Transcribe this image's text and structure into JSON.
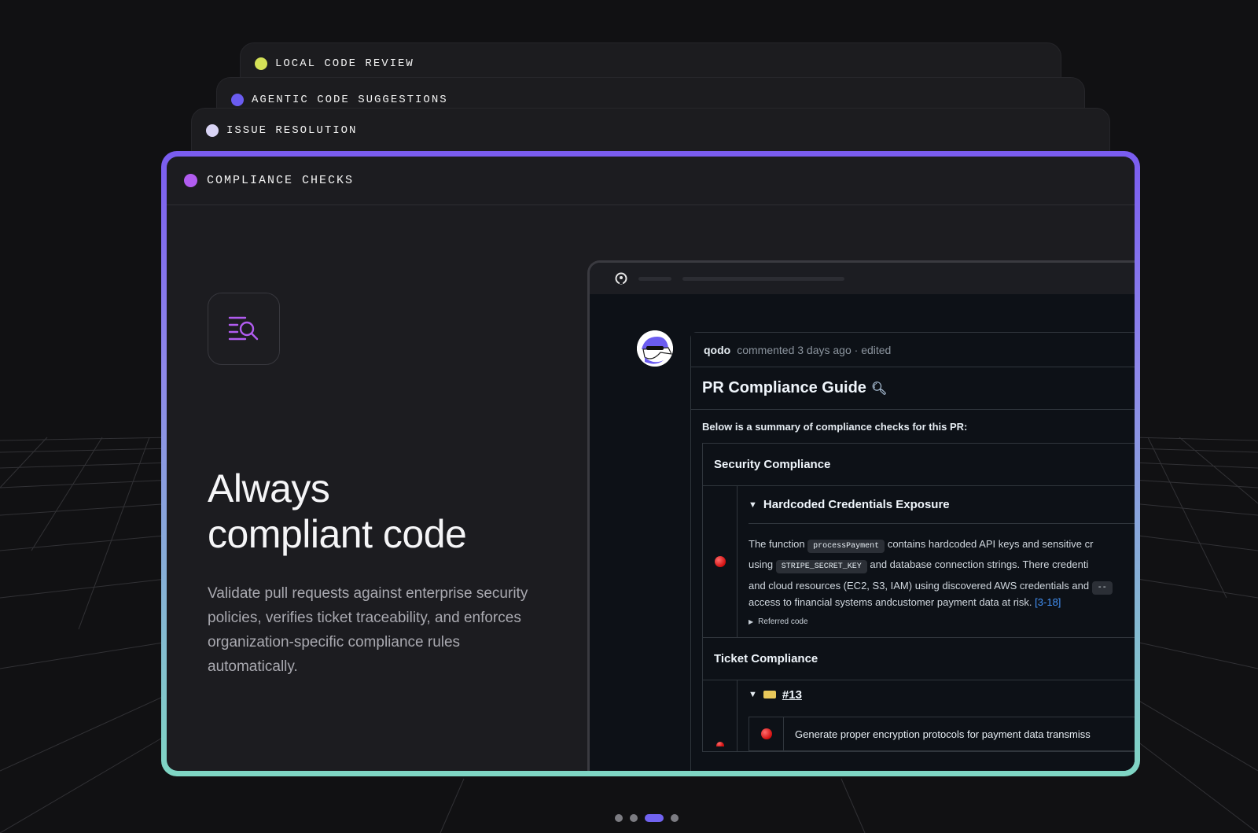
{
  "tabs": [
    {
      "label": "LOCAL CODE REVIEW",
      "dot_color": "#d4e157"
    },
    {
      "label": "AGENTIC CODE SUGGESTIONS",
      "dot_color": "#6b5cf0"
    },
    {
      "label": "ISSUE RESOLUTION",
      "dot_color": "#d9d4f5"
    },
    {
      "label": "COMPLIANCE CHECKS",
      "dot_color": "#b15cf0"
    }
  ],
  "hero": {
    "icon": "search-list-icon",
    "headline_line1": "Always",
    "headline_line2": "compliant code",
    "description": "Validate pull requests against enterprise security policies, verifies ticket traceability, and enforces organization-specific compliance rules automatically."
  },
  "browser": {
    "icon": "github-icon",
    "comment": {
      "user": "qodo",
      "meta": "commented 3 days ago · edited",
      "title": "PR Compliance Guide",
      "title_icon": "magnifier-icon",
      "summary": "Below is a summary of compliance checks for this PR:",
      "sections": {
        "security": "Security Compliance",
        "security_item_title": "Hardcoded Credentials Exposure",
        "text_1a": "The function",
        "code_1": "processPayment",
        "text_1b": "contains hardcoded API keys and sensitive cr",
        "text_2a": "using",
        "code_2": "STRIPE_SECRET_KEY",
        "text_2b": "and database connection strings. There credenti",
        "text_3a": "and cloud resources (EC2, S3, IAM) using discovered AWS credentials and",
        "code_3": "--",
        "text_4a": "access to financial systems andcustomer payment data at risk.",
        "link_4": "[3-18]",
        "referred": "Referred code",
        "ticket": "Ticket Compliance",
        "ticket_id": "#13",
        "ticket_item": "Generate proper encryption protocols for payment data transmiss"
      }
    }
  },
  "pager": {
    "count": 4,
    "active_index": 2
  }
}
